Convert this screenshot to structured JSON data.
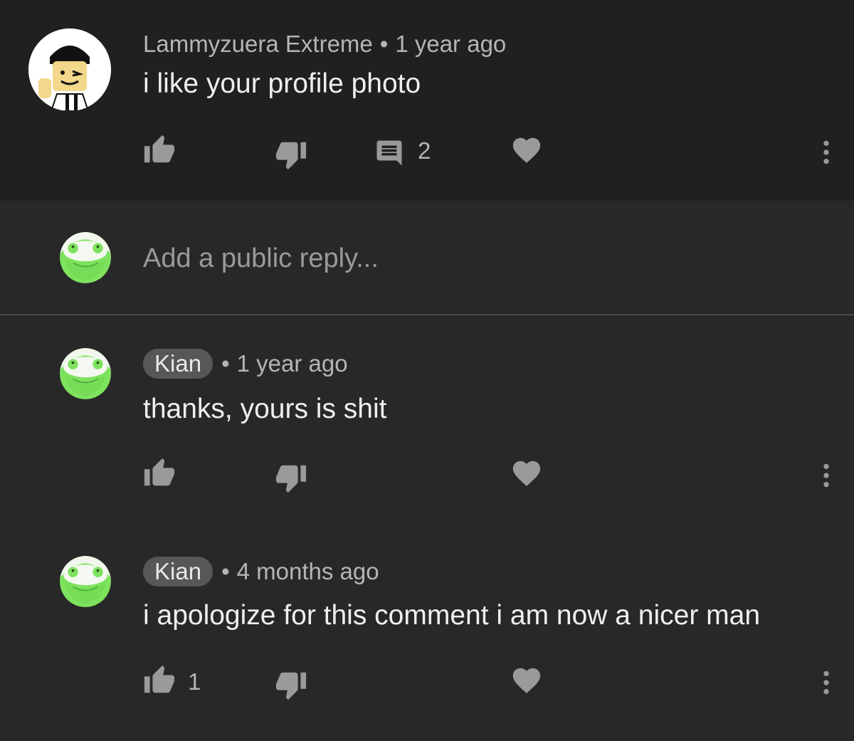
{
  "top_comment": {
    "author": "Lammyzuera Extreme",
    "separator": "•",
    "time": "1 year ago",
    "text": "i like your profile photo",
    "reply_count": "2"
  },
  "reply_box": {
    "placeholder": "Add a public reply..."
  },
  "replies": [
    {
      "author": "Kian",
      "separator": "•",
      "time": "1 year ago",
      "text": "thanks, yours is shit",
      "likes": ""
    },
    {
      "author": "Kian",
      "separator": "•",
      "time": "4 months ago",
      "text": "i apologize for this comment i am now a nicer man",
      "likes": "1"
    }
  ],
  "colors": {
    "background": "#282828",
    "top_comment_background": "#202020",
    "icon": "#9a9a9a",
    "avatar_green": "#7ee25e"
  },
  "icons": [
    "thumb-up-icon",
    "thumb-down-icon",
    "comment-icon",
    "heart-icon",
    "more-vert-icon"
  ]
}
